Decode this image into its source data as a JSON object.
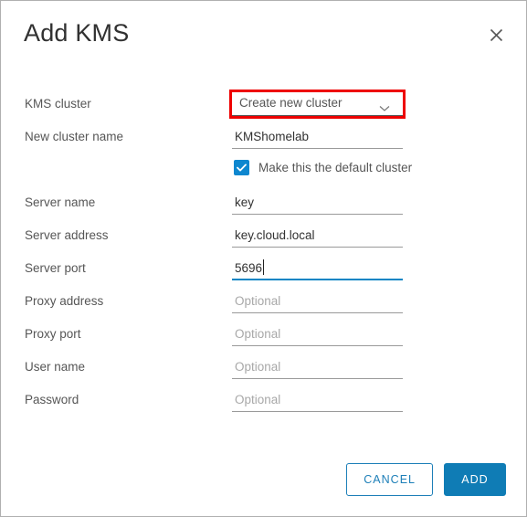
{
  "dialog": {
    "title": "Add KMS",
    "close_icon": "close-icon"
  },
  "form": {
    "rows": [
      {
        "label": "KMS cluster",
        "type": "select",
        "value": "Create new cluster",
        "chevron_icon": "chevron-down-icon",
        "highlighted": true,
        "highlight_color": "#ee0000"
      },
      {
        "label": "New cluster name",
        "type": "text",
        "value": "KMShomelab",
        "placeholder": ""
      },
      {
        "label": "",
        "type": "checkbox",
        "checked": true,
        "check_label": "Make this the default cluster",
        "check_color": "#0e87cf"
      },
      {
        "label": "Server name",
        "type": "text",
        "value": "key",
        "placeholder": ""
      },
      {
        "label": "Server address",
        "type": "text",
        "value": "key.cloud.local",
        "placeholder": ""
      },
      {
        "label": "Server port",
        "type": "text",
        "value": "5696",
        "placeholder": "",
        "focused": true,
        "focus_color": "#0b85c4"
      },
      {
        "label": "Proxy address",
        "type": "text",
        "value": "",
        "placeholder": "Optional"
      },
      {
        "label": "Proxy port",
        "type": "text",
        "value": "",
        "placeholder": "Optional"
      },
      {
        "label": "User name",
        "type": "text",
        "value": "",
        "placeholder": "Optional"
      },
      {
        "label": "Password",
        "type": "text",
        "value": "",
        "placeholder": "Optional"
      }
    ]
  },
  "footer": {
    "cancel_label": "CANCEL",
    "add_label": "ADD",
    "primary_color": "#0f7cb5",
    "secondary_color": "#1d7fb8"
  }
}
